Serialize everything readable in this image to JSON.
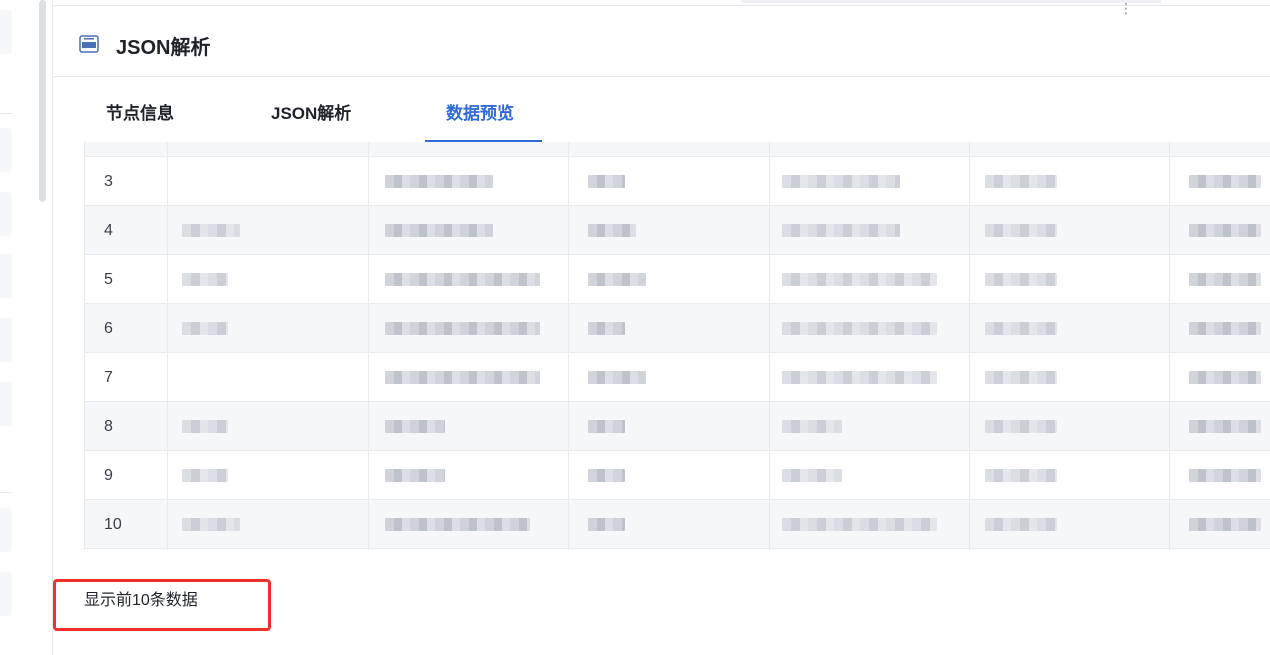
{
  "header": {
    "title": "JSON解析",
    "icon": "json-file-icon",
    "more": "⋮"
  },
  "tabs": [
    {
      "label": "节点信息",
      "active": false
    },
    {
      "label": "JSON解析",
      "active": false
    },
    {
      "label": "数据预览",
      "active": true
    }
  ],
  "table": {
    "row_indices": [
      "3",
      "4",
      "5",
      "6",
      "7",
      "8",
      "9",
      "10"
    ]
  },
  "footer": {
    "note": "显示前10条数据"
  },
  "colors": {
    "accent": "#2f6bd9",
    "highlight": "#f0302b",
    "row_alt": "#f6f7f9"
  }
}
